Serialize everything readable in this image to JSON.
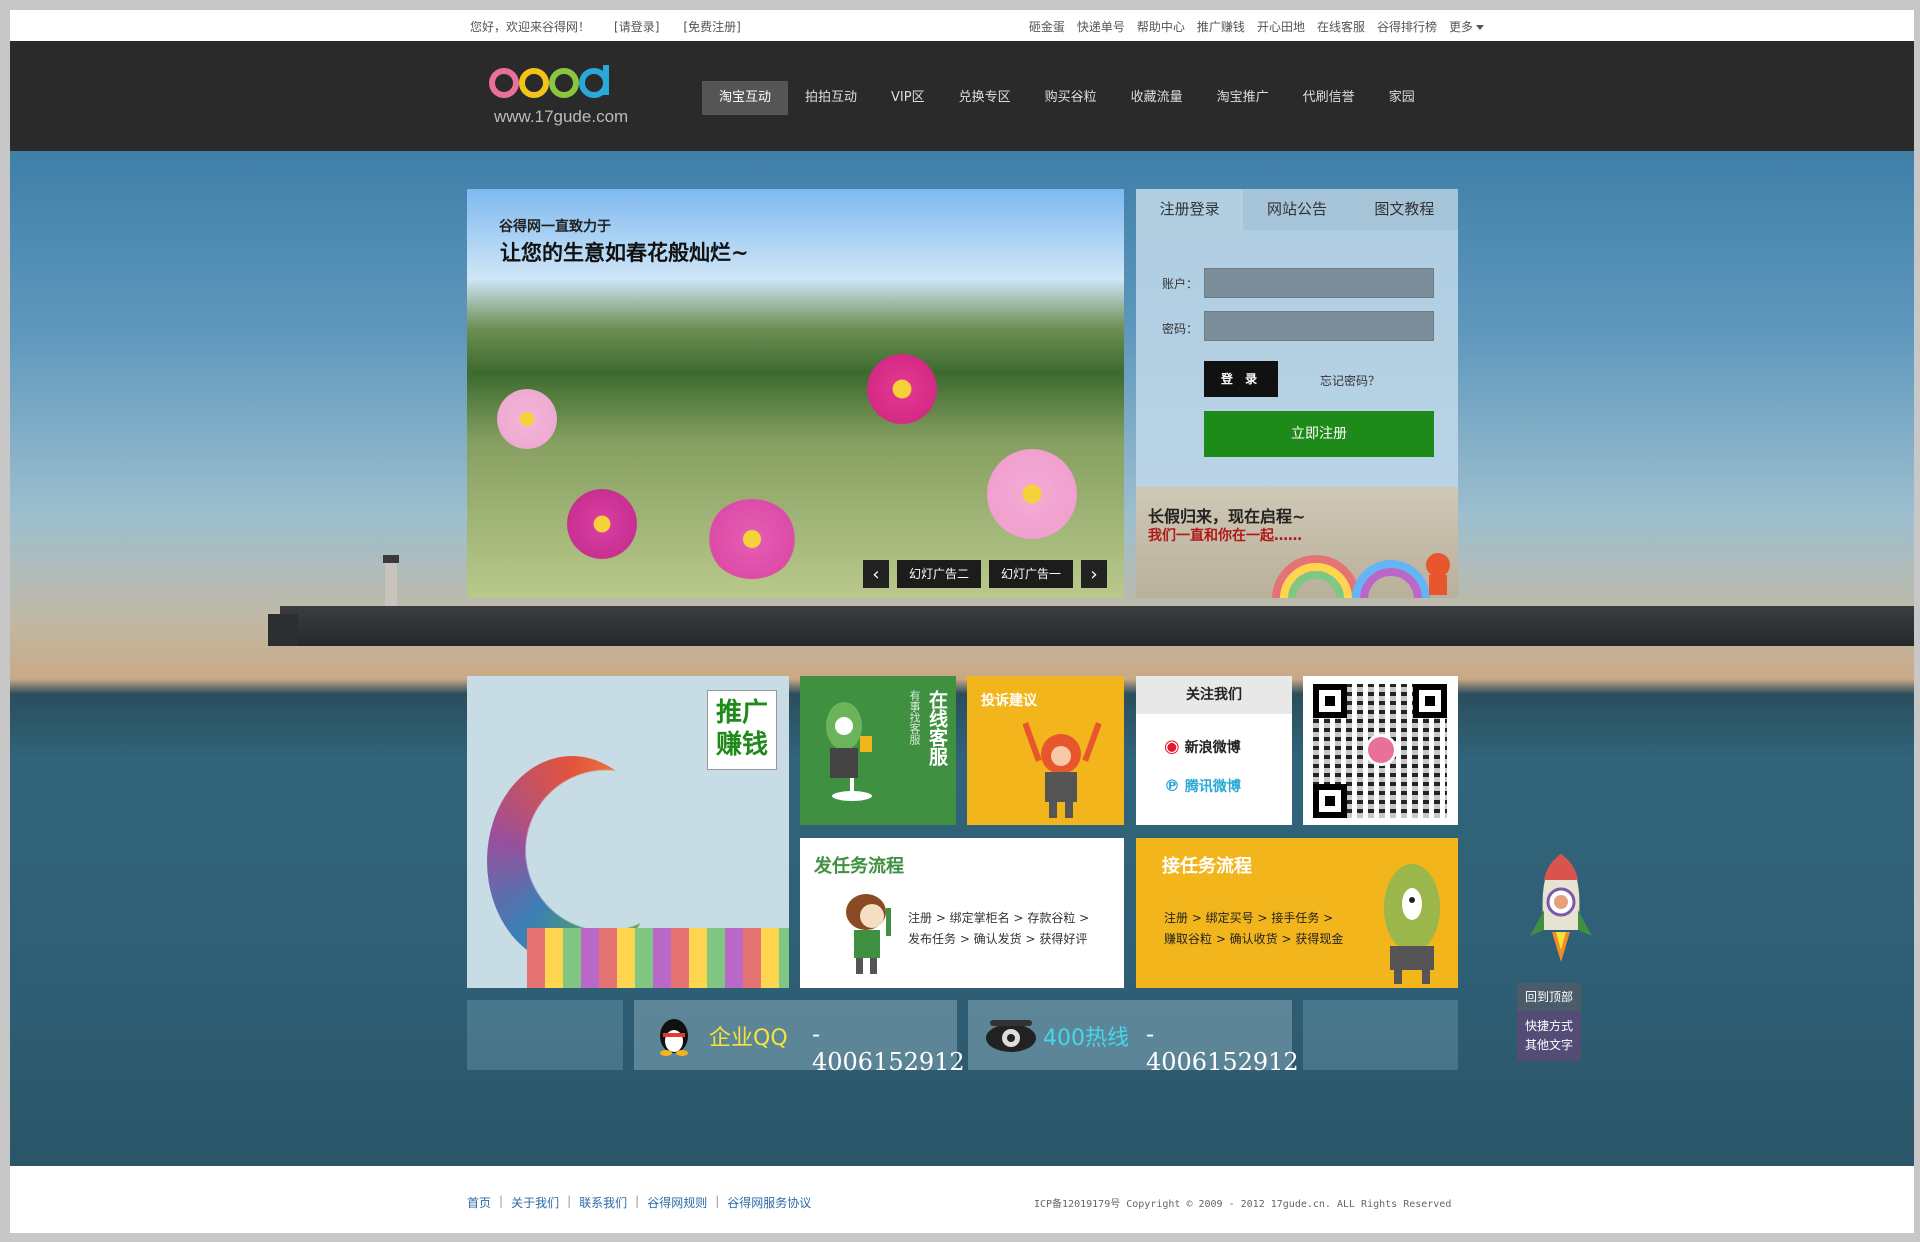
{
  "topbar": {
    "welcome": "您好，欢迎来谷得网！",
    "login": "[请登录]",
    "register": "[免费注册]",
    "links": [
      "砸金蛋",
      "快递单号",
      "帮助中心",
      "推广赚钱",
      "开心田地",
      "在线客服",
      "谷得排行榜"
    ],
    "more": "更多"
  },
  "header": {
    "logo_url": "www.17gude.com",
    "nav": [
      "淘宝互动",
      "拍拍互动",
      "VIP区",
      "兑换专区",
      "购买谷粒",
      "收藏流量",
      "淘宝推广",
      "代刷信誉",
      "家园"
    ]
  },
  "slider": {
    "line1": "谷得网一直致力于",
    "line2": "让您的生意如春花般灿烂~",
    "tabs": [
      "幻灯广告二",
      "幻灯广告一"
    ]
  },
  "login": {
    "tabs": [
      "注册登录",
      "网站公告",
      "图文教程"
    ],
    "account_label": "账户：",
    "password_label": "密码：",
    "login_btn": "登 录",
    "forgot": "忘记密码？",
    "register_btn": "立即注册"
  },
  "small_banner": {
    "line1": "长假归来，现在启程~",
    "line2": "我们一直和你在一起……"
  },
  "tiles": {
    "promo": "推广赚钱",
    "service_big": "在线客服",
    "service_small": "有事找客服",
    "complaint": "投诉建议",
    "follow_title": "关注我们",
    "sina": "新浪微博",
    "tencent": "腾讯微博",
    "post_title": "发任务流程",
    "post_steps_1": "注册  >  绑定掌柜名  >   存款谷粒  >",
    "post_steps_2": "发布任务  >  确认发货  >   获得好评",
    "recv_title": "接任务流程",
    "recv_steps_1": "注册  >  绑定买号  >  接手任务  >",
    "recv_steps_2": "赚取谷粒  >   确认收货  >  获得现金"
  },
  "contact": {
    "qq_label": "企业QQ",
    "qq_number": "- 4006152912",
    "hotline_label": "400热线",
    "hotline_number": "- 4006152912"
  },
  "side": {
    "top": "回到顶部",
    "contact1": "快捷方式",
    "contact2": "其他文字"
  },
  "footer": {
    "links": [
      "首页",
      "关于我们",
      "联系我们",
      "谷得网规则",
      "谷得网服务协议"
    ],
    "copyright": "ICP备12019179号 Copyright © 2009 - 2012 17gude.cn. ALL Rights Reserved"
  },
  "colors": {
    "header_bg": "#2a2a2a",
    "register_green": "#1e8a1a",
    "tile_green": "#3f9040",
    "tile_yellow": "#f2b51c",
    "qq_yellow": "#f5e33a",
    "hotline_cyan": "#45d6e8"
  }
}
